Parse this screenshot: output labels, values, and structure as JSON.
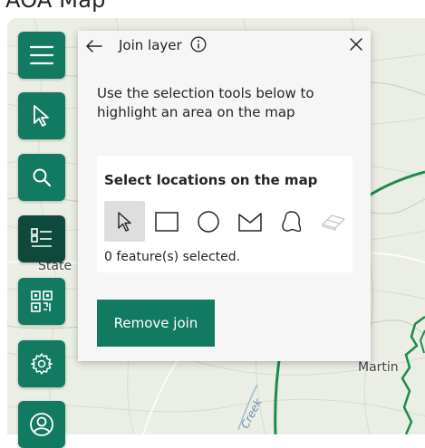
{
  "page": {
    "title": "AOA Map"
  },
  "map": {
    "labels": {
      "state": "State",
      "town": "Martin",
      "creek": "Creek"
    }
  },
  "toolbar": {
    "items": [
      {
        "icon": "hamburger-menu-icon",
        "active": false
      },
      {
        "icon": "cursor-arrow-icon",
        "active": false
      },
      {
        "icon": "search-icon",
        "active": false
      },
      {
        "icon": "layer-list-icon",
        "active": true
      },
      {
        "icon": "qr-code-icon",
        "active": false
      },
      {
        "icon": "gear-icon",
        "active": false
      },
      {
        "icon": "user-icon",
        "active": false
      }
    ]
  },
  "panel": {
    "title": "Join layer",
    "instructions": "Use the selection tools below to highlight an area on the map",
    "select_heading": "Select locations on the map",
    "tools": [
      {
        "icon": "select-arrow-icon",
        "selected": true
      },
      {
        "icon": "rectangle-select-icon",
        "selected": false
      },
      {
        "icon": "circle-select-icon",
        "selected": false
      },
      {
        "icon": "polygon-select-icon",
        "selected": false
      },
      {
        "icon": "lasso-select-icon",
        "selected": false
      },
      {
        "icon": "eraser-icon",
        "selected": false,
        "disabled": true
      }
    ],
    "selected_count": "0 feature(s) selected.",
    "remove_button_label": "Remove join"
  },
  "colors": {
    "accent": "#137a62",
    "active": "#0d4a3b",
    "panel_bg": "#f6f6f6",
    "boundary_line": "#1e8a4c"
  }
}
